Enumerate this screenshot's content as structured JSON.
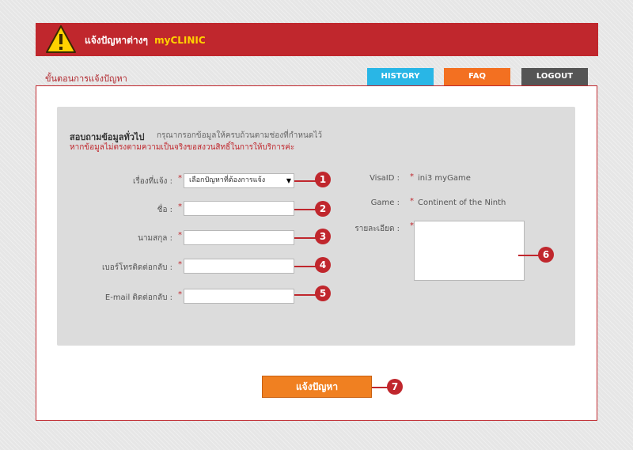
{
  "header": {
    "title": "แจ้งปัญหาต่างๆ",
    "brand": "myCLINIC",
    "warning_icon": "warning-triangle-icon",
    "accent_color": "#c0272d"
  },
  "breadcrumb": "ขั้นตอนการแจ้งปัญหา",
  "tabs": [
    {
      "label": "HISTORY",
      "color": "#29b6e6"
    },
    {
      "label": "FAQ",
      "color": "#f37021"
    },
    {
      "label": "LOGOUT",
      "color": "#555555"
    }
  ],
  "intro": {
    "title": "สอบถามข้อมูลทั่วไป",
    "subtitle": "กรุณากรอกข้อมูลให้ครบถ้วนตามช่องที่กำหนดไว้",
    "warning": "หากข้อมูลไม่ตรงตามความเป็นจริงขอสงวนสิทธิ์ในการให้บริการค่ะ"
  },
  "form": {
    "topic_label": "เรื่องที่แจ้ง :",
    "topic_value": "เลือกปัญหาที่ต้องการแจ้ง",
    "first_name_label": "ชื่อ :",
    "first_name_value": "",
    "last_name_label": "นามสกุล :",
    "last_name_value": "",
    "phone_label": "เบอร์โทรติดต่อกลับ :",
    "phone_value": "",
    "email_label": "E-mail ติดต่อกลับ :",
    "email_value": "",
    "required_mark": "*"
  },
  "info": {
    "visa_id_label": "VisaID :",
    "visa_id_value": "ini3 myGame",
    "game_label": "Game :",
    "game_value": "Continent of the Ninth",
    "details_label": "รายละเอียด :"
  },
  "submit_label": "แจ้งปัญหา",
  "markers": [
    "1",
    "2",
    "3",
    "4",
    "5",
    "6",
    "7"
  ]
}
